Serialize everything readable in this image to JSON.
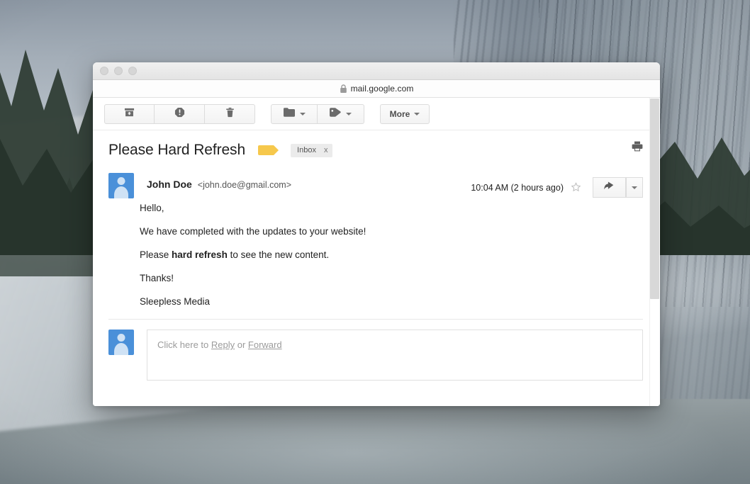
{
  "window": {
    "traffic_lights": [
      "close",
      "minimize",
      "zoom"
    ],
    "url": "mail.google.com",
    "lock_icon": "lock-icon"
  },
  "toolbar": {
    "archive_icon": "archive-icon",
    "spam_icon": "report-spam-icon",
    "delete_icon": "trash-icon",
    "move_to_icon": "folder-icon",
    "labels_icon": "label-tag-icon",
    "more_label": "More"
  },
  "subject": {
    "title": "Please Hard Refresh",
    "label_color": "#f6c84c",
    "chip_label": "Inbox",
    "chip_remove": "x",
    "print_icon": "printer-icon"
  },
  "message": {
    "sender_name": "John Doe",
    "sender_email": "<john.doe@gmail.com>",
    "timestamp": "10:04 AM (2 hours ago)",
    "star_icon": "star-outline-icon",
    "reply_icon": "reply-arrow-icon",
    "more_options_icon": "chevron-down-icon",
    "body": {
      "line1": "Hello,",
      "line2": "We have completed with the updates to your website!",
      "line3_pre": "Please ",
      "line3_bold": "hard refresh",
      "line3_post": " to see the new content.",
      "line4": "Thanks!",
      "line5": "Sleepless Media"
    }
  },
  "reply": {
    "prefix": "Click here to ",
    "reply_link": "Reply",
    "separator": " or ",
    "forward_link": "Forward"
  }
}
